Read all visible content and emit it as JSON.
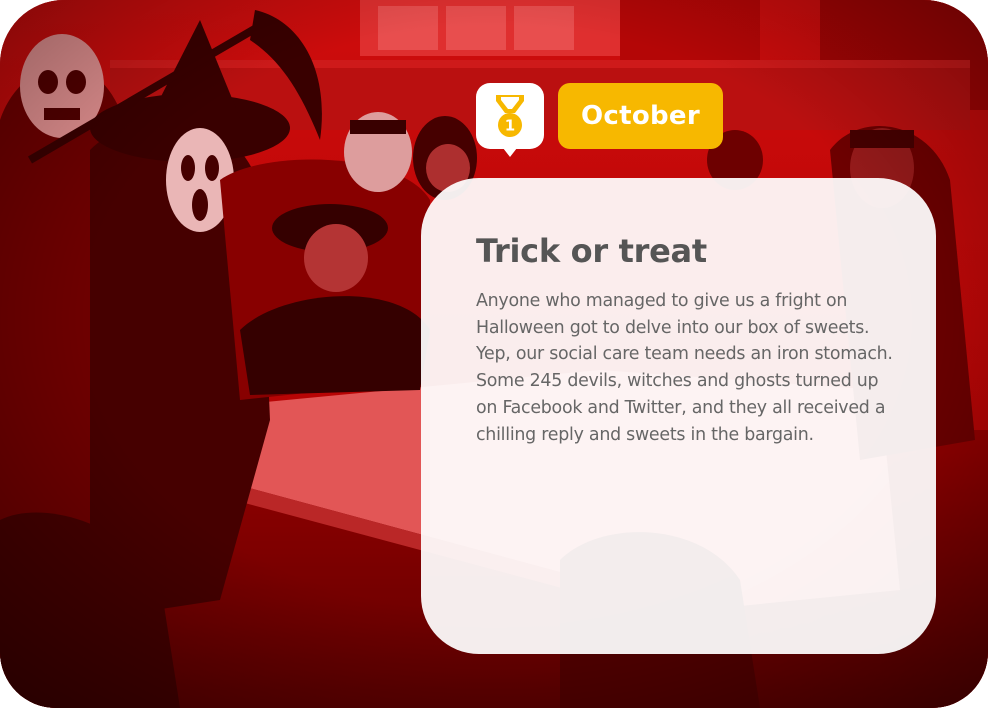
{
  "badge": {
    "icon": "medal-icon",
    "number": "1",
    "colors": {
      "medal": "#f7b800",
      "background": "#ffffff"
    }
  },
  "month": {
    "label": "October",
    "color": "#f7b800"
  },
  "panel": {
    "title": "Trick or treat",
    "body": "Anyone who managed to give us a fright on Halloween got to delve into our box of sweets. Yep, our social care team needs an iron stomach. Some 245 devils, witches and ghosts turned up on Facebook and Twitter, and they all received a chilling reply and sweets in the bargain."
  },
  "photo": {
    "tint_color": "#c80000"
  }
}
